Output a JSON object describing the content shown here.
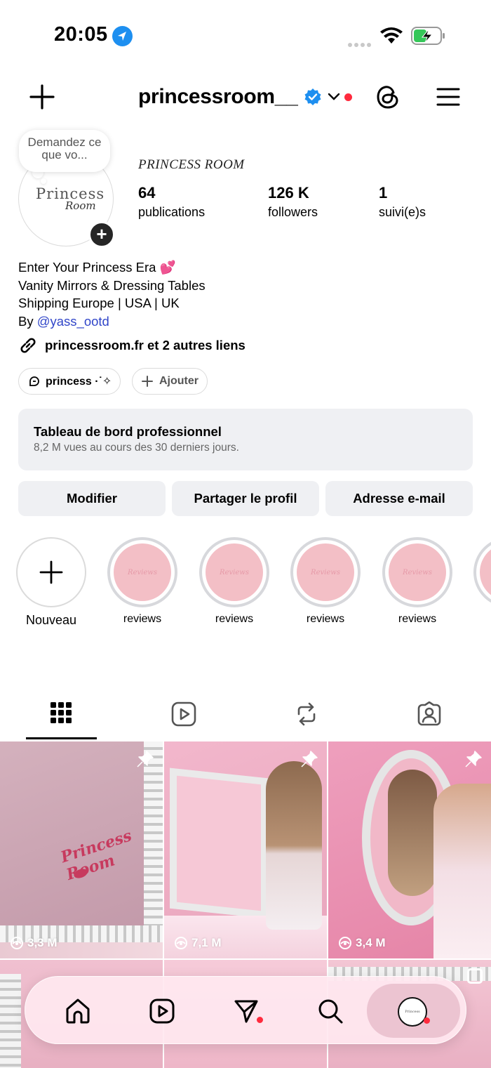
{
  "status_bar": {
    "time": "20:05"
  },
  "header": {
    "username": "princessroom__"
  },
  "profile": {
    "note": "Demandez ce que vo...",
    "avatar_logo_line1": "Princess",
    "avatar_logo_line2": "Room",
    "name": "PRINCESS ROOM",
    "stats": [
      {
        "value": "64",
        "label": "publications"
      },
      {
        "value": "126 K",
        "label": "followers"
      },
      {
        "value": "1",
        "label": "suivi(e)s"
      }
    ],
    "bio": {
      "line1": "Enter Your Princess Era 💕",
      "line2": "Vanity Mirrors & Dressing Tables",
      "line3": "Shipping Europe | USA | UK",
      "line4_prefix": "By ",
      "line4_mention": "@yass_ootd"
    },
    "links": "princessroom.fr et 2 autres liens",
    "chips": {
      "threads": "princess ·˙✧",
      "add": "Ajouter"
    }
  },
  "dashboard": {
    "title": "Tableau de bord professionnel",
    "subtitle": "8,2 M vues au cours des 30 derniers jours."
  },
  "buttons": {
    "edit": "Modifier",
    "share": "Partager le profil",
    "email": "Adresse e-mail"
  },
  "highlights": {
    "new_label": "Nouveau",
    "items": [
      {
        "label": "reviews",
        "cover_text": "Reviews"
      },
      {
        "label": "reviews",
        "cover_text": "Reviews"
      },
      {
        "label": "reviews",
        "cover_text": "Reviews"
      },
      {
        "label": "reviews",
        "cover_text": "Reviews"
      }
    ]
  },
  "grid": {
    "posts": [
      {
        "views": "3,3 M",
        "pinned": true,
        "overlay_text": "Princess Room"
      },
      {
        "views": "7,1 M",
        "pinned": true
      },
      {
        "views": "3,4 M",
        "pinned": true
      }
    ]
  },
  "colors": {
    "accent_blue": "#1d8ff0",
    "mention": "#3146c9",
    "notification_red": "#ff2a3d",
    "panel_gray": "#eff0f3",
    "highlight_pink": "#f3bfc6"
  }
}
